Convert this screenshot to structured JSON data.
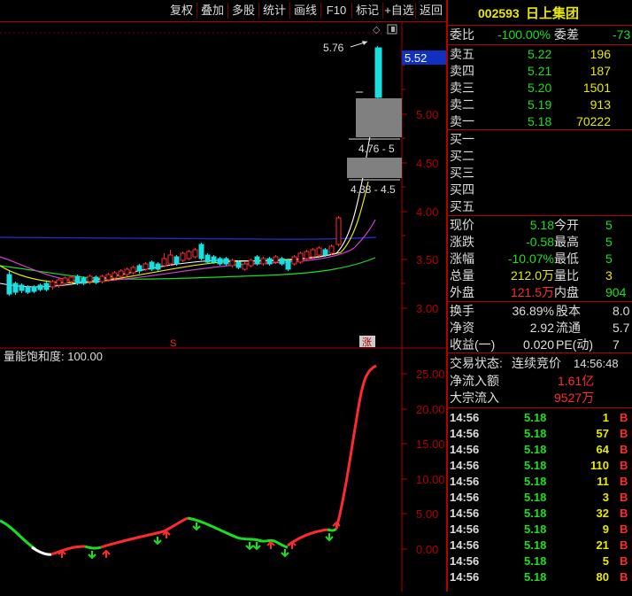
{
  "toolbar": {
    "buttons": [
      "复权",
      "叠加",
      "多股",
      "统计",
      "画线",
      "F10",
      "标记",
      "+自选",
      "返回"
    ]
  },
  "main_chart": {
    "price_axis": [
      "5.00",
      "4.50",
      "4.00",
      "3.50",
      "3.00"
    ],
    "current_price_tag": "5.52",
    "annotation_high": "5.76",
    "annotation_box1": "4.76 - 5",
    "annotation_box2": "4.38 - 4.5",
    "marker_s": "S",
    "marker_zhang": "涨",
    "colors": {
      "up": "#ff2b2b",
      "down": "#19e0e0",
      "ma1": "#ffffff",
      "ma2": "#e8e800",
      "ma3": "#d040d0",
      "ma4": "#19e01f",
      "ma5": "#2030d0"
    }
  },
  "sub_chart": {
    "title": "量能饱和度: 100.00",
    "axis": [
      "25.00",
      "20.00",
      "15.00",
      "10.00",
      "5.00",
      "0.00"
    ]
  },
  "quote": {
    "code": "002593",
    "name": "日上集团",
    "weibi_label": "委比",
    "weibi": "-100.00%",
    "weicha_label": "委差",
    "weicha": "-73",
    "asks": [
      {
        "label": "卖五",
        "price": "5.22",
        "vol": "196"
      },
      {
        "label": "卖四",
        "price": "5.21",
        "vol": "187"
      },
      {
        "label": "卖三",
        "price": "5.20",
        "vol": "1501"
      },
      {
        "label": "卖二",
        "price": "5.19",
        "vol": "913"
      },
      {
        "label": "卖一",
        "price": "5.18",
        "vol": "70222"
      }
    ],
    "bids": [
      {
        "label": "买一"
      },
      {
        "label": "买二"
      },
      {
        "label": "买三"
      },
      {
        "label": "买四"
      },
      {
        "label": "买五"
      }
    ],
    "stats_left": [
      {
        "label": "现价",
        "value": "5.18",
        "color": "g"
      },
      {
        "label": "涨跌",
        "value": "-0.58",
        "color": "g"
      },
      {
        "label": "涨幅",
        "value": "-10.07%",
        "color": "g"
      },
      {
        "label": "总量",
        "value": "212.0万",
        "color": "y"
      },
      {
        "label": "外盘",
        "value": "121.5万",
        "color": "r"
      }
    ],
    "stats_right": [
      {
        "label": "今开",
        "value": "5",
        "color": "g"
      },
      {
        "label": "最高",
        "value": "5",
        "color": "g"
      },
      {
        "label": "最低",
        "value": "5",
        "color": "g"
      },
      {
        "label": "量比",
        "value": "3",
        "color": "y"
      },
      {
        "label": "内盘",
        "value": "904",
        "color": "g"
      }
    ],
    "extra_left": [
      {
        "label": "换手",
        "value": "36.89%"
      },
      {
        "label": "净资",
        "value": "2.92"
      },
      {
        "label": "收益(一)",
        "value": "0.020"
      }
    ],
    "extra_right": [
      {
        "label": "股本",
        "value": "8.0"
      },
      {
        "label": "流通",
        "value": "5.7"
      },
      {
        "label": "PE(动)",
        "value": "7"
      }
    ],
    "trade_status_label": "交易状态:",
    "trade_status": "连续竞价",
    "trade_time": "14:56:48",
    "net_inflow_label": "净流入额",
    "net_inflow": "1.61亿",
    "block_inflow_label": "大宗流入",
    "block_inflow": "9527万"
  },
  "ticks": [
    {
      "time": "14:56",
      "price": "5.18",
      "vol": "1",
      "side": "B"
    },
    {
      "time": "14:56",
      "price": "5.18",
      "vol": "57",
      "side": "B"
    },
    {
      "time": "14:56",
      "price": "5.18",
      "vol": "64",
      "side": "B"
    },
    {
      "time": "14:56",
      "price": "5.18",
      "vol": "110",
      "side": "B"
    },
    {
      "time": "14:56",
      "price": "5.18",
      "vol": "11",
      "side": "B"
    },
    {
      "time": "14:56",
      "price": "5.18",
      "vol": "3",
      "side": "B"
    },
    {
      "time": "14:56",
      "price": "5.18",
      "vol": "32",
      "side": "B"
    },
    {
      "time": "14:56",
      "price": "5.18",
      "vol": "9",
      "side": "B"
    },
    {
      "time": "14:56",
      "price": "5.18",
      "vol": "21",
      "side": "B"
    },
    {
      "time": "14:56",
      "price": "5.18",
      "vol": "5",
      "side": "B"
    },
    {
      "time": "14:56",
      "price": "5.18",
      "vol": "80",
      "side": "B"
    }
  ]
}
